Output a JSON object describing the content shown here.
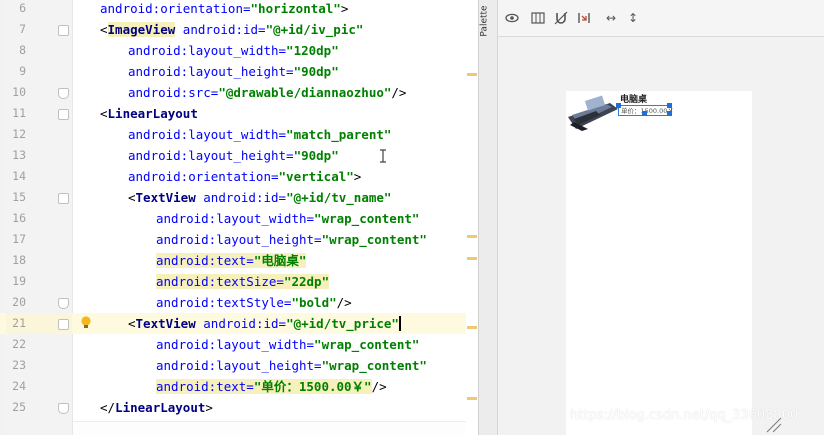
{
  "editor": {
    "lines": [
      {
        "num": "6",
        "tokens": [
          {
            "t": "android:orientation=",
            "k": "attr"
          },
          {
            "t": "\"horizontal\"",
            "k": "val"
          },
          {
            "t": ">",
            "k": "punc"
          }
        ]
      },
      {
        "num": "7",
        "tokens": [
          {
            "t": "<",
            "k": "punc"
          },
          {
            "t": "ImageView",
            "k": "tag",
            "hl": true
          },
          {
            "t": " android:id=",
            "k": "attr"
          },
          {
            "t": "\"@+id/iv_pic\"",
            "k": "val"
          }
        ]
      },
      {
        "num": "8",
        "tokens": [
          {
            "t": "android:layout_width=",
            "k": "attr"
          },
          {
            "t": "\"120dp\"",
            "k": "val"
          }
        ]
      },
      {
        "num": "9",
        "tokens": [
          {
            "t": "android:layout_height=",
            "k": "attr"
          },
          {
            "t": "\"90dp\"",
            "k": "val"
          }
        ]
      },
      {
        "num": "10",
        "tokens": [
          {
            "t": "android:src=",
            "k": "attr"
          },
          {
            "t": "\"@drawable/diannaozhuo\"",
            "k": "val"
          },
          {
            "t": "/>",
            "k": "punc"
          }
        ]
      },
      {
        "num": "11",
        "tokens": [
          {
            "t": "<",
            "k": "punc"
          },
          {
            "t": "LinearLayout",
            "k": "tag"
          }
        ]
      },
      {
        "num": "12",
        "tokens": [
          {
            "t": "android:layout_width=",
            "k": "attr"
          },
          {
            "t": "\"match_parent\"",
            "k": "val"
          }
        ]
      },
      {
        "num": "13",
        "tokens": [
          {
            "t": "android:layout_height=",
            "k": "attr"
          },
          {
            "t": "\"90dp\"",
            "k": "val"
          }
        ]
      },
      {
        "num": "14",
        "tokens": [
          {
            "t": "android:orientation=",
            "k": "attr"
          },
          {
            "t": "\"vertical\"",
            "k": "val"
          },
          {
            "t": ">",
            "k": "punc"
          }
        ]
      },
      {
        "num": "15",
        "tokens": [
          {
            "t": "<",
            "k": "punc"
          },
          {
            "t": "TextView",
            "k": "tag"
          },
          {
            "t": " android:id=",
            "k": "attr"
          },
          {
            "t": "\"@+id/tv_name\"",
            "k": "val"
          }
        ]
      },
      {
        "num": "16",
        "tokens": [
          {
            "t": "android:layout_width=",
            "k": "attr"
          },
          {
            "t": "\"wrap_content\"",
            "k": "val"
          }
        ]
      },
      {
        "num": "17",
        "tokens": [
          {
            "t": "android:layout_height=",
            "k": "attr"
          },
          {
            "t": "\"wrap_content\"",
            "k": "val"
          }
        ]
      },
      {
        "num": "18",
        "tokens": [
          {
            "t": "android:text=",
            "k": "attr",
            "hl": true
          },
          {
            "t": "\"电脑桌\"",
            "k": "val",
            "hl": true
          }
        ]
      },
      {
        "num": "19",
        "tokens": [
          {
            "t": "android:textSize=",
            "k": "attr",
            "hl": true
          },
          {
            "t": "\"22dp\"",
            "k": "val",
            "hl": true
          }
        ]
      },
      {
        "num": "20",
        "tokens": [
          {
            "t": "android:textStyle=",
            "k": "attr"
          },
          {
            "t": "\"bold\"",
            "k": "val"
          },
          {
            "t": "/>",
            "k": "punc"
          }
        ]
      },
      {
        "num": "21",
        "tokens": [
          {
            "t": "<",
            "k": "punc"
          },
          {
            "t": "TextView",
            "k": "tag"
          },
          {
            "t": " android:id=",
            "k": "attr"
          },
          {
            "t": "\"@+id/tv_price\"",
            "k": "val"
          }
        ]
      },
      {
        "num": "22",
        "tokens": [
          {
            "t": "android:layout_width=",
            "k": "attr"
          },
          {
            "t": "\"wrap_content\"",
            "k": "val"
          }
        ]
      },
      {
        "num": "23",
        "tokens": [
          {
            "t": "android:layout_height=",
            "k": "attr"
          },
          {
            "t": "\"wrap_content\"",
            "k": "val"
          }
        ]
      },
      {
        "num": "24",
        "tokens": [
          {
            "t": "android:text=",
            "k": "attr",
            "hl": true
          },
          {
            "t": "\"单价：1500.00￥\"",
            "k": "val",
            "hl": true
          },
          {
            "t": "/>",
            "k": "punc"
          }
        ]
      },
      {
        "num": "25",
        "tokens": [
          {
            "t": "</",
            "k": "punc"
          },
          {
            "t": "LinearLayout",
            "k": "tag"
          },
          {
            "t": ">",
            "k": "punc"
          }
        ]
      }
    ]
  },
  "palette": {
    "label": "Palette"
  },
  "toolbar": {
    "icons": [
      "eye-icon",
      "blueprint-icon",
      "magnet-icon",
      "infer-constraints-icon",
      "expand-horizontal-icon",
      "expand-vertical-icon"
    ]
  },
  "preview": {
    "name": "电脑桌",
    "price": "单价：1500.00￥"
  },
  "watermark": "https://blog.csdn.net/qq_33608000",
  "colors": {
    "tag": "#000080",
    "attr": "#0000ff",
    "value": "#008000",
    "highlight": "#f6f0bc",
    "current_line": "#fdfae0",
    "selection": "#1e6fd9"
  }
}
